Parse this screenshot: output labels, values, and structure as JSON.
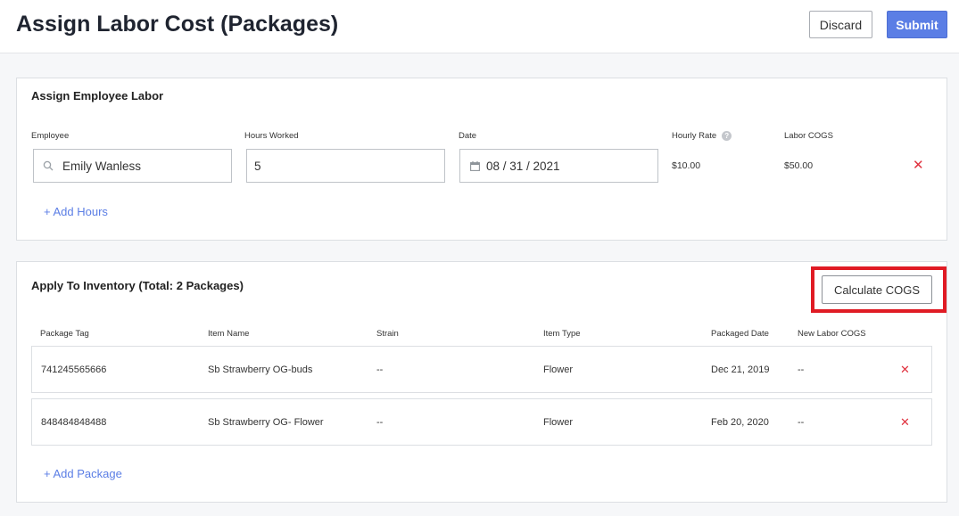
{
  "header": {
    "title": "Assign Labor Cost (Packages)",
    "discard_label": "Discard",
    "submit_label": "Submit"
  },
  "labor": {
    "title": "Assign Employee Labor",
    "labels": {
      "employee": "Employee",
      "hours": "Hours Worked",
      "date": "Date",
      "rate": "Hourly Rate",
      "cogs": "Labor COGS"
    },
    "entry": {
      "employee": "Emily Wanless",
      "hours": "5",
      "date": "08 / 31 / 2021",
      "rate": "$10.00",
      "cogs": "$50.00"
    },
    "add_hours_label": "+ Add Hours",
    "info_icon": "question-icon"
  },
  "inventory": {
    "title": "Apply To Inventory (Total: 2 Packages)",
    "calc_label": "Calculate COGS",
    "columns": [
      "Package Tag",
      "Item Name",
      "Strain",
      "Item Type",
      "Packaged Date",
      "New Labor COGS"
    ],
    "rows": [
      {
        "tag": "741245565666",
        "name": "Sb Strawberry OG-buds",
        "strain": "--",
        "type": "Flower",
        "date": "Dec 21, 2019",
        "cogs": "--"
      },
      {
        "tag": "848484848488",
        "name": "Sb Strawberry OG- Flower",
        "strain": "--",
        "type": "Flower",
        "date": "Feb 20, 2020",
        "cogs": "--"
      }
    ],
    "add_package_label": "+ Add Package"
  },
  "colors": {
    "accent": "#5b7ee5",
    "remove": "#e0323f",
    "highlight": "#e01b24"
  }
}
